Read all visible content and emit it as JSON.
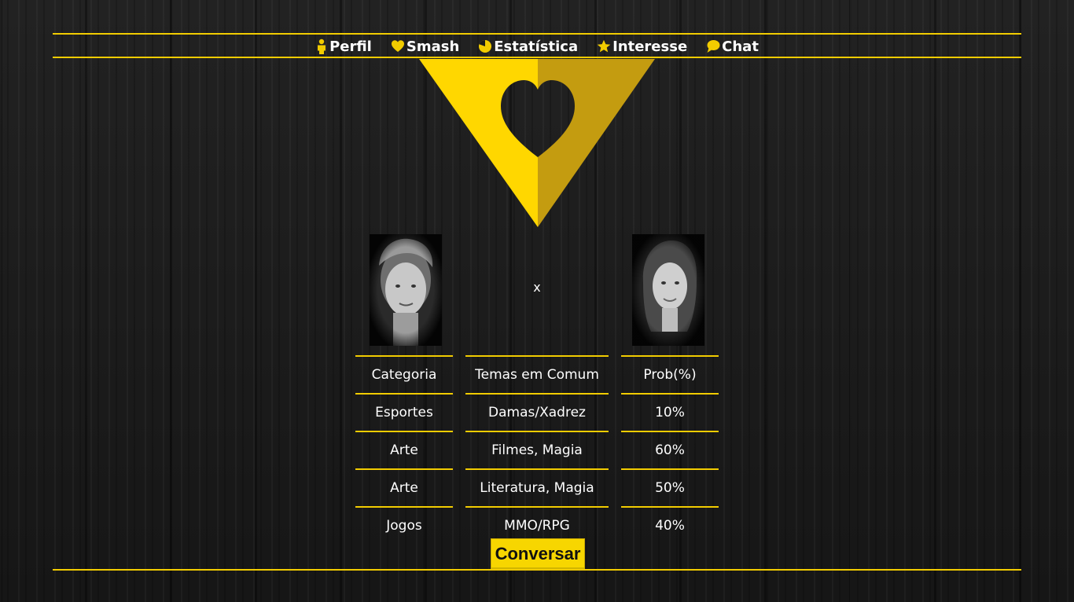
{
  "nav": {
    "items": [
      {
        "label": "Perfil",
        "icon": "person-icon"
      },
      {
        "label": "Smash",
        "icon": "heart-icon"
      },
      {
        "label": "Estatística",
        "icon": "pie-chart-icon"
      },
      {
        "label": "Interesse",
        "icon": "star-icon"
      },
      {
        "label": "Chat",
        "icon": "speech-bubble-icon"
      }
    ]
  },
  "match": {
    "separator": "x",
    "left_photo": "person-photo",
    "right_photo": "person-photo"
  },
  "table": {
    "headers": [
      "Categoria",
      "Temas em Comum",
      "Prob(%)"
    ],
    "rows": [
      [
        "Esportes",
        "Damas/Xadrez",
        "10%"
      ],
      [
        "Arte",
        "Filmes, Magia",
        "60%"
      ],
      [
        "Arte",
        "Literatura, Magia",
        "50%"
      ],
      [
        "Jogos",
        "MMO/RPG",
        "40%"
      ]
    ]
  },
  "actions": {
    "conversar_label": "Conversar"
  },
  "colors": {
    "accent": "#f2cc00",
    "accent_dark": "#c49c10",
    "text": "#ffffff",
    "background": "#1b1b1b"
  }
}
